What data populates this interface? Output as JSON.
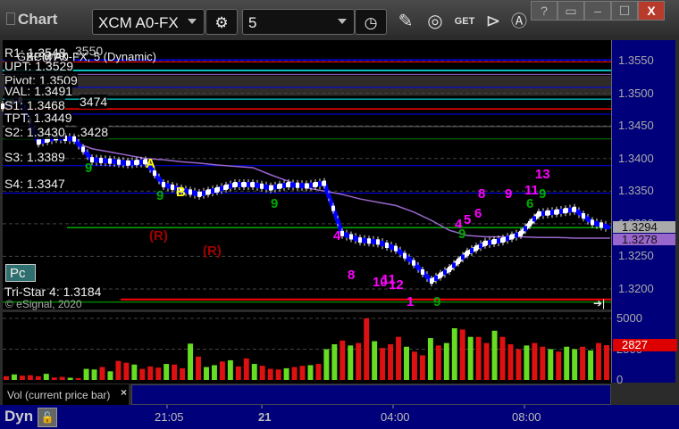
{
  "window": {
    "title": "Chart",
    "symbol": "XCM A0-FX",
    "interval": "5",
    "buttons": [
      "?",
      "window-menu",
      "minimize",
      "maximize",
      "close"
    ],
    "close_label": "X",
    "help_label": "?"
  },
  "toolbar_icons": [
    "gear-icon",
    "clock-icon",
    "pencil-icon",
    "chart-line-icon",
    "get-icon",
    "play-icon",
    "a-icon"
  ],
  "get_label": "GET",
  "chart": {
    "title_back": "GBP@FX",
    "title": "XCM A0-FX, 5 (Dynamic)",
    "copyright": "© eSignal, 2020",
    "pc_label": "Pc",
    "levels": [
      {
        "label": "R1: 1.3548",
        "price": 1.3548,
        "color": "#ff0000"
      },
      {
        "label": "UPT: 1.3529",
        "price": 1.3529,
        "color": "#9966cc"
      },
      {
        "label": "Pivot: 1.3509",
        "price": 1.3509,
        "color": "#0000ff"
      },
      {
        "label": "VAL: 1.3491",
        "price": 1.3491,
        "color": "#00ffff"
      },
      {
        "label": "S1: 1.3468",
        "price": 1.3468,
        "color": "#0000ff"
      },
      {
        "label": "TPT: 1.3449",
        "price": 1.3449,
        "color": "#666666"
      },
      {
        "label": "S2: 1.3430",
        "price": 1.343,
        "color": "#008000"
      },
      {
        "label": "S3: 1.3389",
        "price": 1.3389,
        "color": "#0000ff"
      },
      {
        "label": "S4: 1.3347",
        "price": 1.3347,
        "color": "#0000ff"
      },
      {
        "label": "Tri-Star 4: 1.3184",
        "price": 1.3184,
        "color": "#ff0000"
      }
    ],
    "extra_lines": [
      {
        "price": 1.3551,
        "color": "#0000ff"
      },
      {
        "price": 1.3535,
        "color": "#00ffff"
      },
      {
        "price": 1.3476,
        "color": "#ff0000"
      },
      {
        "price": 1.3294,
        "color": "#00aa00"
      },
      {
        "price": 1.318,
        "color": "#008000"
      }
    ],
    "overlap_text": [
      "3550",
      "3474",
      ".3428"
    ],
    "price_ticks": [
      "1.3550",
      "1.3500",
      "1.3450",
      "1.3400",
      "1.3350",
      "1.3300",
      "1.3250",
      "1.3200"
    ],
    "last_price": "1.3294",
    "ma_value": "1.3278",
    "colors": {
      "up": "#ffffff",
      "down": "#0000ff",
      "ma": "#9966cc",
      "tag_price": "#aaaaaa",
      "tag_ma": "#9966cc"
    },
    "annotations": [
      {
        "text": "A",
        "i": 8,
        "price": 1.3392,
        "color": "#ffff00"
      },
      {
        "text": "B",
        "i": 9.7,
        "price": 1.3347,
        "color": "#ffff00"
      },
      {
        "text": "9",
        "i": 4.6,
        "price": 1.3384,
        "color": "#00aa00"
      },
      {
        "text": "9",
        "i": 8.6,
        "price": 1.3342,
        "color": "#00aa00"
      },
      {
        "text": "9",
        "i": 15,
        "price": 1.333,
        "color": "#00aa00"
      },
      {
        "text": "(R)",
        "i": 8.2,
        "price": 1.328,
        "color": "#a00000"
      },
      {
        "text": "(R)",
        "i": 11.2,
        "price": 1.3257,
        "color": "#a00000"
      },
      {
        "text": "4",
        "i": 18.5,
        "price": 1.328,
        "color": "#ff00ff"
      },
      {
        "text": "8",
        "i": 19.3,
        "price": 1.322,
        "color": "#ff00ff"
      },
      {
        "text": "10",
        "i": 20.7,
        "price": 1.321,
        "color": "#ff00ff"
      },
      {
        "text": "11",
        "i": 21.2,
        "price": 1.3214,
        "color": "#ff00ff"
      },
      {
        "text": "12",
        "i": 21.6,
        "price": 1.3205,
        "color": "#ff00ff"
      },
      {
        "text": "1",
        "i": 22.6,
        "price": 1.318,
        "color": "#ff00ff"
      },
      {
        "text": "9",
        "i": 24.1,
        "price": 1.318,
        "color": "#00aa00"
      },
      {
        "text": "4",
        "i": 25.3,
        "price": 1.3298,
        "color": "#ff00ff"
      },
      {
        "text": "5",
        "i": 25.8,
        "price": 1.3305,
        "color": "#ff00ff"
      },
      {
        "text": "6",
        "i": 26.4,
        "price": 1.3315,
        "color": "#ff00ff"
      },
      {
        "text": "8",
        "i": 26.6,
        "price": 1.3345,
        "color": "#ff00ff"
      },
      {
        "text": "9",
        "i": 28.1,
        "price": 1.3345,
        "color": "#ff00ff"
      },
      {
        "text": "11",
        "i": 29.2,
        "price": 1.335,
        "color": "#ff00ff"
      },
      {
        "text": "9",
        "i": 30,
        "price": 1.3345,
        "color": "#00aa00"
      },
      {
        "text": "6",
        "i": 29.3,
        "price": 1.333,
        "color": "#00aa00"
      },
      {
        "text": "13",
        "i": 29.8,
        "price": 1.3375,
        "color": "#ff00ff"
      },
      {
        "text": "9",
        "i": 25.5,
        "price": 1.3283,
        "color": "#00aa00"
      }
    ]
  },
  "chart_data": {
    "type": "line",
    "price_ylim": [
      1.316,
      1.358
    ],
    "close": [
      1.348,
      1.349,
      1.3425,
      1.3432,
      1.343,
      1.3398,
      1.3396,
      1.3393,
      1.3395,
      1.336,
      1.3352,
      1.3345,
      1.3352,
      1.336,
      1.336,
      1.3355,
      1.336,
      1.3358,
      1.3362,
      1.3285,
      1.3275,
      1.3272,
      1.3262,
      1.324,
      1.3212,
      1.323,
      1.3255,
      1.327,
      1.3275,
      1.3285,
      1.3315,
      1.3318,
      1.3322,
      1.3302,
      1.3294
    ],
    "ma": [
      null,
      null,
      null,
      null,
      1.3425,
      1.3415,
      1.341,
      1.3405,
      1.34,
      1.3398,
      1.3395,
      1.3393,
      1.339,
      1.3388,
      1.3386,
      1.3375,
      1.3365,
      1.3355,
      1.335,
      1.3345,
      1.3338,
      1.3333,
      1.3328,
      1.3318,
      1.3305,
      1.329,
      1.3282,
      1.328,
      1.328,
      1.328,
      1.3279,
      1.3279,
      1.3278,
      1.3278,
      1.3278
    ],
    "volume_ticks": [
      "5000",
      "2500",
      "0"
    ],
    "volume_label": "Vol (current price bar)",
    "volume_last": "2827",
    "volume": [
      300,
      450,
      350,
      380,
      300,
      500,
      200,
      250,
      180,
      150,
      900,
      850,
      1050,
      700,
      1550,
      1400,
      1250,
      900,
      1100,
      1000,
      1300,
      1250,
      950,
      2950,
      1900,
      1050,
      1200,
      1500,
      1600,
      1100,
      1750,
      1300,
      1150,
      900,
      850,
      950,
      1050,
      1150,
      1200,
      1300,
      2500,
      2900,
      3200,
      2800,
      3000,
      5000,
      3150,
      2600,
      2900,
      3500,
      2700,
      2300,
      2000,
      3400,
      2800,
      3000,
      4200,
      4100,
      3500,
      3500,
      3000,
      4000,
      3500,
      2900,
      2500,
      2800,
      3000,
      2700,
      2500,
      2300,
      2700,
      2500,
      2700,
      2400,
      3000,
      2827
    ],
    "time_ticks": [
      {
        "label": "21:05",
        "bold": false
      },
      {
        "label": "21",
        "bold": true
      },
      {
        "label": "04:00",
        "bold": false
      },
      {
        "label": "08:00",
        "bold": false
      }
    ]
  },
  "footer": {
    "dyn_label": "Dyn"
  }
}
